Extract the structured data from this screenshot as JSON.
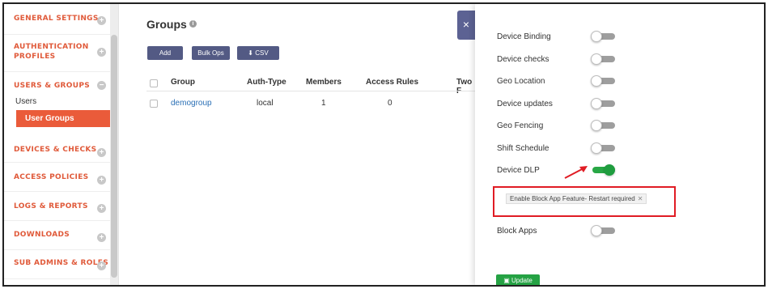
{
  "sidebar": {
    "sections": [
      {
        "label": "GENERAL SETTINGS"
      },
      {
        "label": "AUTHENTICATION PROFILES"
      },
      {
        "label": "USERS & GROUPS"
      },
      {
        "label": "DEVICES & CHECKS"
      },
      {
        "label": "ACCESS POLICIES"
      },
      {
        "label": "LOGS & REPORTS"
      },
      {
        "label": "DOWNLOADS"
      },
      {
        "label": "SUB ADMINS & ROLES"
      }
    ],
    "sub_items": {
      "users": "Users",
      "user_groups": "User Groups"
    }
  },
  "main": {
    "title": "Groups",
    "buttons": {
      "add": "Add",
      "bulk_ops": "Bulk Ops",
      "csv": "CSV"
    },
    "table": {
      "headers": [
        "Group",
        "Auth-Type",
        "Members",
        "Access Rules",
        "Two F"
      ],
      "rows": [
        {
          "group": "demogroup",
          "auth_type": "local",
          "members": "1",
          "access_rules": "0"
        }
      ]
    }
  },
  "panel": {
    "close_label": "×",
    "settings": [
      {
        "label": "Device Binding",
        "enabled": false
      },
      {
        "label": "Device checks",
        "enabled": false
      },
      {
        "label": "Geo Location",
        "enabled": false
      },
      {
        "label": "Device updates",
        "enabled": false
      },
      {
        "label": "Geo Fencing",
        "enabled": false
      },
      {
        "label": "Shift Schedule",
        "enabled": false
      },
      {
        "label": "Device DLP",
        "enabled": true
      }
    ],
    "dlp_tag": "Enable Block App Feature- Restart required",
    "block_apps": {
      "label": "Block Apps",
      "enabled": false
    },
    "update_button": "Update"
  },
  "colors": {
    "sidebar_text": "#e05a3a",
    "active_item": "#ea5b3a",
    "button_bg": "#535a84",
    "toggle_on": "#28a745",
    "highlight": "#e01c24",
    "link": "#2a6fb5"
  }
}
